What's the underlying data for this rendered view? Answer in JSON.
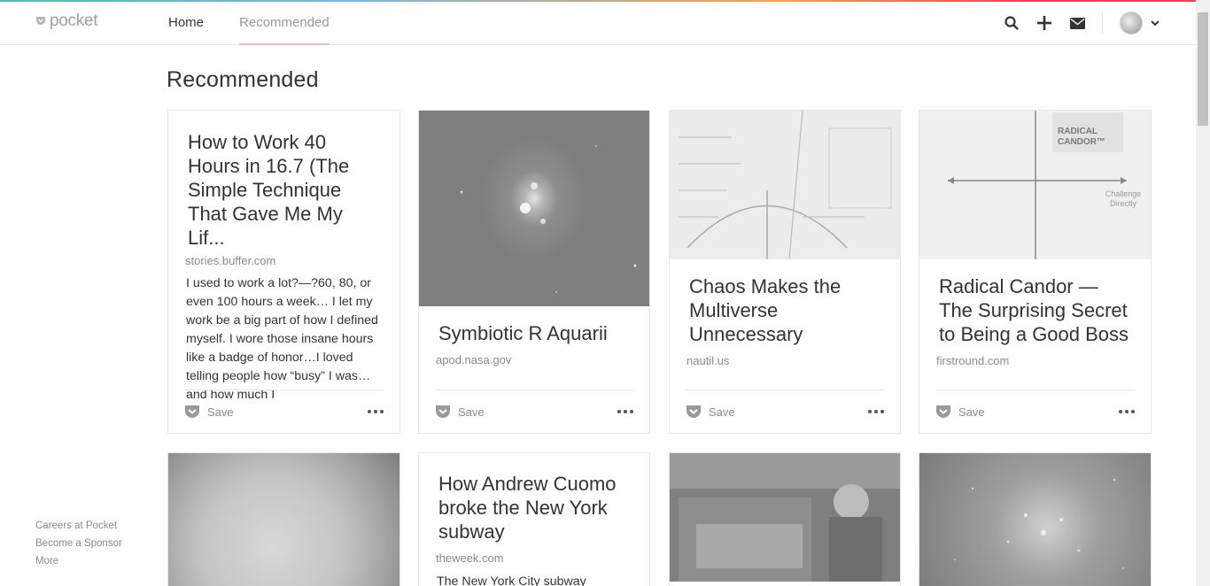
{
  "app": {
    "logo_text": "pocket"
  },
  "nav": {
    "items": [
      "Home",
      "Recommended"
    ],
    "active": "Recommended"
  },
  "page": {
    "title": "Recommended"
  },
  "cards": [
    {
      "title": "How to Work 40 Hours in 16.7 (The Simple Technique That Gave Me My Lif...",
      "domain": "stories.buffer.com",
      "excerpt": "I used to work a lot?—?60, 80, or even 100 hours a week… I let my work be a big part of how I defined myself. I wore those insane hours like a badge of honor…I loved telling people how “busy” I was…and how much I",
      "save": "Save"
    },
    {
      "title": "Symbiotic R Aquarii",
      "domain": "apod.nasa.gov",
      "save": "Save"
    },
    {
      "title": "Chaos Makes the Multiverse Unnecessary",
      "domain": "nautil.us",
      "save": "Save"
    },
    {
      "title": "Radical Candor — The Surprising Secret to Being a Good Boss",
      "domain": "firstround.com",
      "save": "Save",
      "image_text": {
        "label": "RADICAL CANDOR™",
        "axis": "Challenge Directly"
      }
    },
    {
      "title": "How Andrew Cuomo broke the New York subway",
      "domain": "theweek.com",
      "excerpt": "The New York City subway"
    }
  ],
  "footer": {
    "links": [
      "Careers at Pocket",
      "Become a Sponsor",
      "More"
    ]
  },
  "icons": [
    "pocket-logo-icon",
    "search-icon",
    "plus-icon",
    "mail-icon",
    "avatar",
    "chevron-down-icon",
    "save-icon",
    "more-icon"
  ]
}
